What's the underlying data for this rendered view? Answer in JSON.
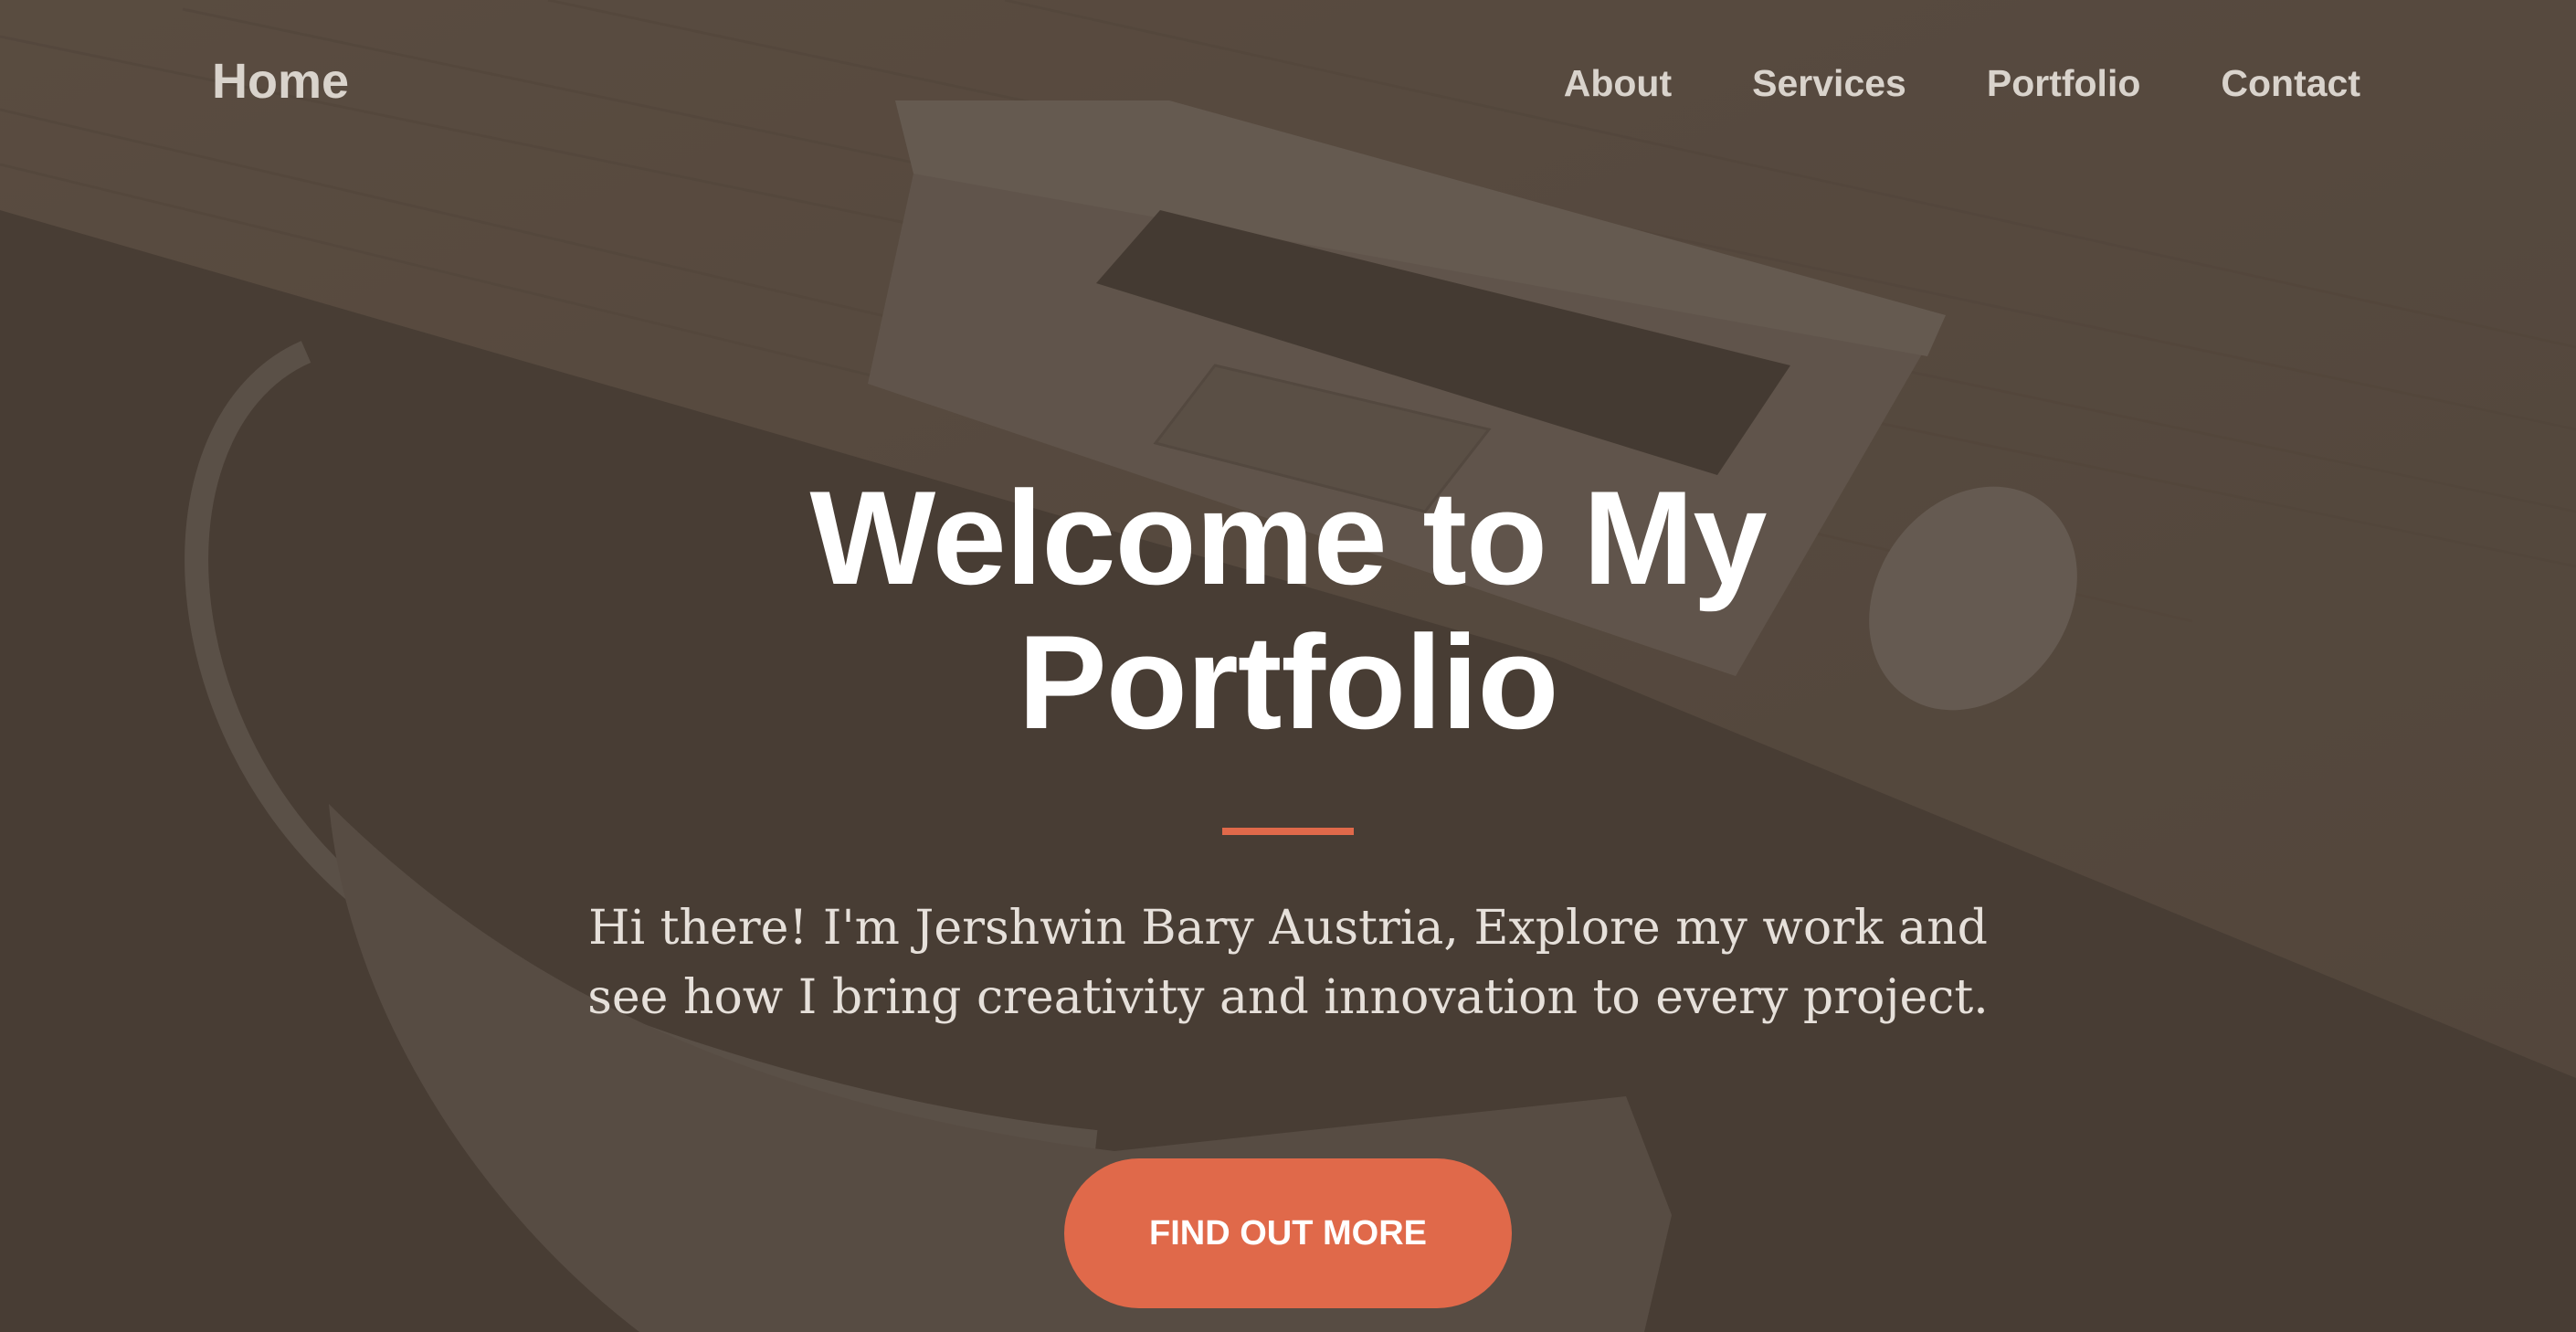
{
  "nav": {
    "brand": "Home",
    "links": [
      "About",
      "Services",
      "Portfolio",
      "Contact"
    ]
  },
  "hero": {
    "title": "Welcome to My Portfolio",
    "subtitle": "Hi there! I'm Jershwin Bary Austria, Explore my work and see how I bring creativity and innovation to every project.",
    "cta_label": "FIND OUT MORE"
  },
  "colors": {
    "accent": "#e0694a",
    "overlay": "#4a3f36",
    "nav_text": "#d9d3cc",
    "title_text": "#ffffff"
  },
  "background": {
    "description_icon": "laptop-desk-photo"
  }
}
